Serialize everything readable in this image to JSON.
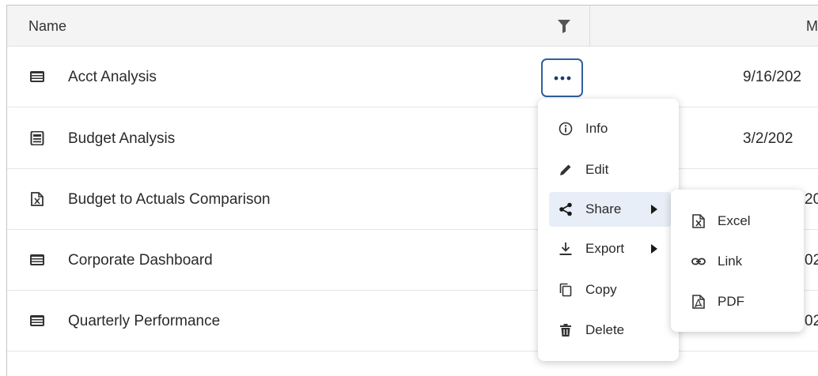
{
  "table": {
    "headers": {
      "name": "Name",
      "modified": "M"
    },
    "rows": [
      {
        "name": "Acct Analysis",
        "date": "9/16/202",
        "icon": "dashboard-icon"
      },
      {
        "name": "Budget Analysis",
        "date": "3/2/202",
        "icon": "report-icon"
      },
      {
        "name": "Budget to Actuals Comparison",
        "date": "20",
        "icon": "excel-report-icon"
      },
      {
        "name": "Corporate Dashboard",
        "date": "02",
        "icon": "dashboard-icon"
      },
      {
        "name": "Quarterly Performance",
        "date": "02",
        "icon": "dashboard-icon"
      }
    ]
  },
  "menu": {
    "items": [
      {
        "label": "Info",
        "icon": "info-icon"
      },
      {
        "label": "Edit",
        "icon": "pencil-icon"
      },
      {
        "label": "Share",
        "icon": "share-icon",
        "active": true,
        "submenu": true
      },
      {
        "label": "Export",
        "icon": "download-icon",
        "submenu": true
      },
      {
        "label": "Copy",
        "icon": "copy-icon"
      },
      {
        "label": "Delete",
        "icon": "trash-icon"
      }
    ]
  },
  "submenu": {
    "items": [
      {
        "label": "Excel",
        "icon": "excel-file-icon"
      },
      {
        "label": "Link",
        "icon": "link-icon"
      },
      {
        "label": "PDF",
        "icon": "pdf-file-icon"
      }
    ]
  },
  "colors": {
    "header_bg": "#f4f4f4",
    "accent": "#2f5f9e",
    "active_item_bg": "#e8eef7",
    "icon_dark": "#333333"
  }
}
